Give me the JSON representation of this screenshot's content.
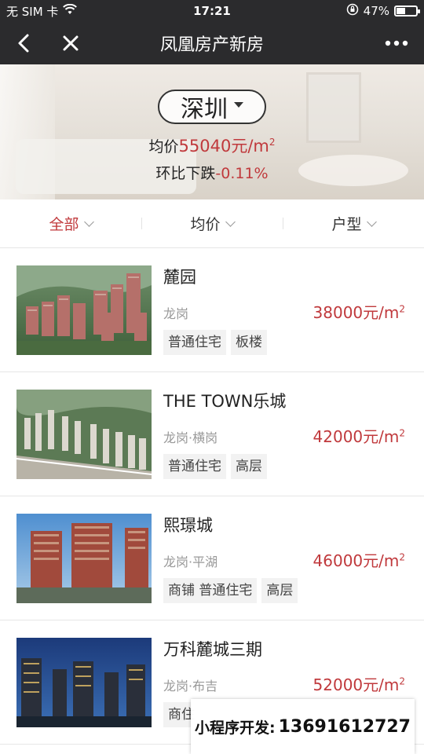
{
  "status": {
    "carrier": "无 SIM 卡",
    "time": "17:21",
    "battery": "47%",
    "battery_level": 0.47
  },
  "nav": {
    "title": "凤凰房产新房"
  },
  "hero": {
    "city": "深圳",
    "avg_label": "均价",
    "avg_value": "55040元/m",
    "avg_unit_sup": "2",
    "mom_label": "环比下跌",
    "mom_value": "-0.11%"
  },
  "filters": [
    {
      "label": "全部",
      "active": true
    },
    {
      "label": "均价",
      "active": false
    },
    {
      "label": "户型",
      "active": false
    }
  ],
  "listings": [
    {
      "name": "麓园",
      "district": "龙岗",
      "price": "38000元/m",
      "price_sup": "2",
      "tags": [
        "普通住宅",
        "板楼"
      ]
    },
    {
      "name": "THE TOWN乐城",
      "district": "龙岗·横岗",
      "price": "42000元/m",
      "price_sup": "2",
      "tags": [
        "普通住宅",
        "高层"
      ]
    },
    {
      "name": "熙璟城",
      "district": "龙岗·平湖",
      "price": "46000元/m",
      "price_sup": "2",
      "tags": [
        "商铺 普通住宅",
        "高层"
      ]
    },
    {
      "name": "万科麓城三期",
      "district": "龙岗·布吉",
      "price": "52000元/m",
      "price_sup": "2",
      "tags": [
        "商住"
      ]
    }
  ],
  "watermark": {
    "label": "小程序开发:",
    "phone": "13691612727"
  },
  "colors": {
    "accent": "#c0393c",
    "navbar": "#2b2b2d"
  }
}
